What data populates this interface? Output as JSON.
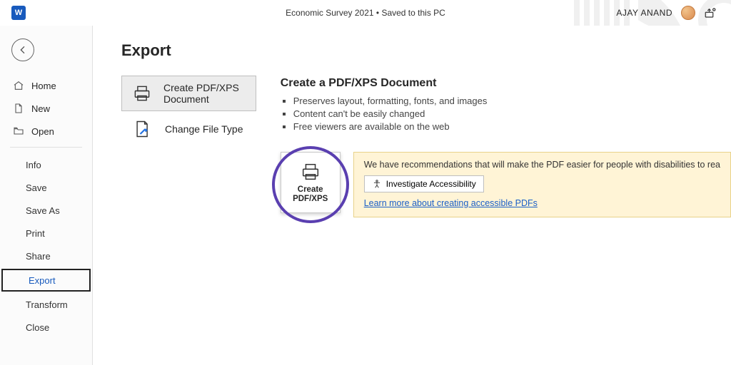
{
  "titlebar": {
    "doc_title": "Economic Survey 2021 • Saved to this PC",
    "username": "AJAY ANAND"
  },
  "nav": {
    "home": "Home",
    "new": "New",
    "open": "Open",
    "info": "Info",
    "save": "Save",
    "save_as": "Save As",
    "print": "Print",
    "share": "Share",
    "export": "Export",
    "transform": "Transform",
    "close": "Close"
  },
  "page": {
    "title": "Export",
    "option_pdf": "Create PDF/XPS Document",
    "option_changetype": "Change File Type",
    "right_title": "Create a PDF/XPS Document",
    "bullets": [
      "Preserves layout, formatting, fonts, and images",
      "Content can't be easily changed",
      "Free viewers are available on the web"
    ],
    "big_button_line1": "Create",
    "big_button_line2": "PDF/XPS",
    "reco_text": "We have recommendations that will make the PDF easier for people with disabilities to rea",
    "reco_button": "Investigate Accessibility",
    "reco_link": "Learn more about creating accessible PDFs"
  }
}
